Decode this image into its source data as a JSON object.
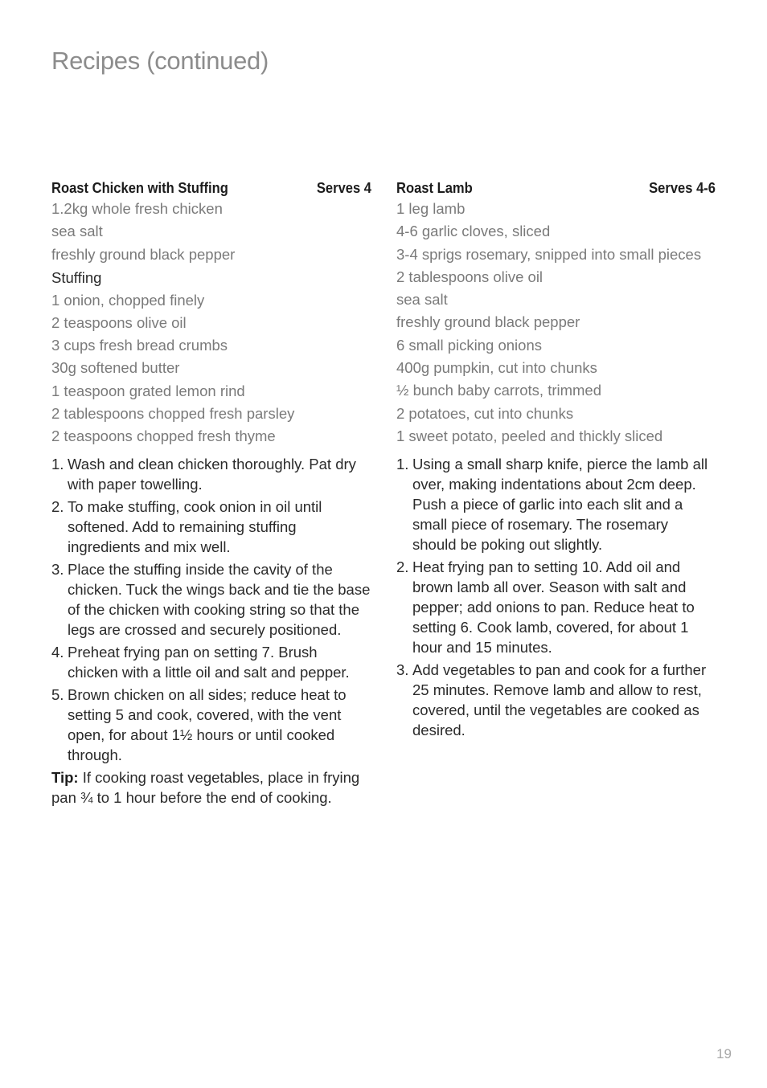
{
  "page": {
    "title": "Recipes (continued)",
    "page_number": "19"
  },
  "recipes": [
    {
      "name": "Roast Chicken with Stuffing",
      "serves": "Serves 4",
      "ingredients": [
        "1.2kg whole fresh chicken",
        "sea salt",
        "freshly ground black pepper"
      ],
      "sub_heading": "Stuffing",
      "sub_ingredients": [
        "1 onion, chopped finely",
        "2 teaspoons olive oil",
        "3 cups fresh bread crumbs",
        "30g softened butter",
        "1 teaspoon grated lemon rind",
        "2 tablespoons chopped fresh parsley",
        "2 teaspoons chopped fresh thyme"
      ],
      "steps": [
        {
          "num": "1.",
          "text": "Wash and clean chicken thoroughly. Pat dry with paper towelling."
        },
        {
          "num": "2.",
          "text": "To make stuffing, cook onion in oil until softened. Add to remaining stuffing ingredients and mix well."
        },
        {
          "num": "3.",
          "text": "Place the stuffing inside the cavity of the chicken. Tuck the wings back and tie the base of the chicken with cooking string so that the legs are crossed and securely positioned."
        },
        {
          "num": "4.",
          "text": "Preheat frying pan on setting 7. Brush chicken with a little oil and salt and pepper."
        },
        {
          "num": "5.",
          "text": "Brown chicken on all sides; reduce heat to setting 5 and cook, covered, with the vent open, for about 1½ hours or until cooked through."
        }
      ],
      "tip_label": "Tip:",
      "tip_text": " If cooking roast vegetables, place in frying pan ¾ to 1 hour before the end of cooking."
    },
    {
      "name": "Roast Lamb",
      "serves": "Serves 4-6",
      "ingredients": [
        "1 leg lamb",
        "4-6 garlic cloves, sliced",
        "3-4 sprigs rosemary, snipped into small pieces",
        "2 tablespoons olive oil",
        "sea salt",
        "freshly ground black pepper",
        "6 small picking onions",
        "400g pumpkin, cut into chunks",
        "½ bunch baby carrots, trimmed",
        "2 potatoes, cut into chunks",
        "1 sweet potato, peeled and thickly sliced"
      ],
      "steps": [
        {
          "num": "1.",
          "text": "Using a small sharp knife, pierce the lamb all over, making indentations about 2cm deep. Push a piece of garlic into each slit and a small piece of rosemary. The rosemary should be poking out slightly."
        },
        {
          "num": "2.",
          "text": "Heat frying pan to setting 10. Add oil and brown lamb all over. Season with salt and pepper; add onions to pan. Reduce heat to setting 6. Cook lamb, covered, for about 1 hour and 15 minutes."
        },
        {
          "num": "3.",
          "text": "Add vegetables to pan and cook for a further 25 minutes. Remove lamb and allow to rest, covered, until the vegetables are cooked as desired."
        }
      ]
    }
  ]
}
